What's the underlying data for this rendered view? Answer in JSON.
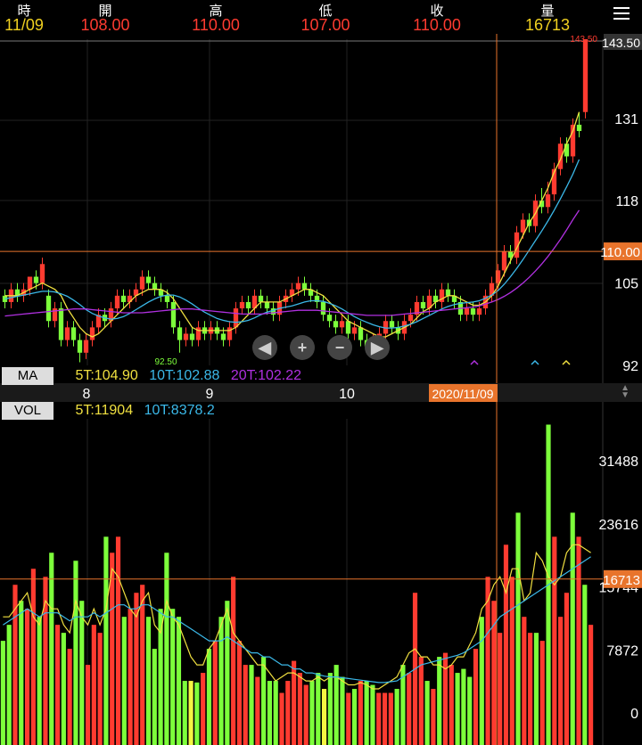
{
  "header": {
    "labels": [
      "時",
      "開",
      "高",
      "低",
      "收",
      "量"
    ],
    "values": [
      "11/09",
      "108.00",
      "110.00",
      "107.00",
      "110.00",
      "16713"
    ],
    "colors": [
      "#f0d020",
      "#ff3b30",
      "#ff3b30",
      "#ff3b30",
      "#ff3b30",
      "#f0d020"
    ]
  },
  "indicators": {
    "ma_tag": "MA",
    "ma5": "5T:104.90",
    "ma10": "10T:102.88",
    "ma20": "20T:102.22",
    "vol_tag": "VOL",
    "vol5": "5T:11904",
    "vol10": "10T:8378.2"
  },
  "colors": {
    "up": "#ff3b30",
    "down": "#7dff3b",
    "flat": "#f5f542",
    "ma5": "#f0e040",
    "ma10": "#3bb8e8",
    "ma20": "#b030e0",
    "cursor": "#e8742c"
  },
  "chart_data": [
    {
      "type": "candlestick",
      "y_ticks": [
        92,
        105,
        118,
        131,
        143.5
      ],
      "ylim": [
        92,
        143.5
      ],
      "cursor_value": "110.00",
      "high_label": "143.50",
      "low_label": "92.50",
      "x_labels": [
        "8",
        "9",
        "10",
        "2020/11/09"
      ],
      "candles": [
        [
          103,
          102,
          104,
          101
        ],
        [
          102,
          104,
          105,
          101
        ],
        [
          104,
          103,
          105,
          102
        ],
        [
          103,
          104,
          105,
          102
        ],
        [
          104,
          106,
          106,
          103
        ],
        [
          106,
          105,
          107,
          104
        ],
        [
          105,
          108,
          109,
          104
        ],
        [
          103,
          99,
          104,
          98
        ],
        [
          99,
          101,
          102,
          98
        ],
        [
          101,
          96,
          102,
          95
        ],
        [
          96,
          98,
          99,
          95
        ],
        [
          98,
          96,
          99,
          95
        ],
        [
          96,
          94,
          97,
          92.5
        ],
        [
          94,
          96,
          97,
          93
        ],
        [
          96,
          98,
          99,
          95
        ],
        [
          98,
          100,
          101,
          97
        ],
        [
          100,
          99,
          101,
          98
        ],
        [
          99,
          101,
          102,
          98
        ],
        [
          101,
          103,
          104,
          100
        ],
        [
          103,
          102,
          104,
          101
        ],
        [
          102,
          103,
          104,
          101
        ],
        [
          103,
          104,
          105,
          102
        ],
        [
          104,
          106,
          107,
          103
        ],
        [
          106,
          105,
          107,
          104
        ],
        [
          105,
          104,
          106,
          103
        ],
        [
          104,
          103,
          105,
          102
        ],
        [
          103,
          102,
          104,
          101
        ],
        [
          102,
          98,
          103,
          97
        ],
        [
          98,
          96,
          99,
          94
        ],
        [
          96,
          97,
          98,
          95
        ],
        [
          97,
          96,
          98,
          95
        ],
        [
          96,
          98,
          99,
          95
        ],
        [
          98,
          97,
          99,
          96
        ],
        [
          97,
          98,
          99,
          96
        ],
        [
          98,
          97,
          99,
          96
        ],
        [
          97,
          96,
          98,
          95
        ],
        [
          96,
          98,
          99,
          95
        ],
        [
          98,
          101,
          102,
          97
        ],
        [
          101,
          102,
          103,
          100
        ],
        [
          102,
          101,
          103,
          100
        ],
        [
          101,
          103,
          104,
          100
        ],
        [
          103,
          102,
          104,
          101
        ],
        [
          102,
          101,
          103,
          100
        ],
        [
          101,
          100,
          102,
          99
        ],
        [
          100,
          102,
          103,
          99
        ],
        [
          102,
          103,
          104,
          101
        ],
        [
          103,
          104,
          105,
          102
        ],
        [
          104,
          105,
          106,
          103
        ],
        [
          105,
          104,
          106,
          103
        ],
        [
          104,
          103,
          105,
          102
        ],
        [
          103,
          102,
          104,
          101
        ],
        [
          102,
          100,
          103,
          99
        ],
        [
          100,
          99,
          101,
          98
        ],
        [
          99,
          98,
          100,
          97
        ],
        [
          98,
          99,
          100,
          97
        ],
        [
          99,
          97,
          100,
          96
        ],
        [
          97,
          98,
          99,
          96
        ],
        [
          98,
          96,
          99,
          95
        ],
        [
          96,
          95,
          97,
          94
        ],
        [
          95,
          96,
          97,
          94
        ],
        [
          96,
          97,
          98,
          95
        ],
        [
          97,
          99,
          100,
          96
        ],
        [
          99,
          98,
          100,
          97
        ],
        [
          98,
          97,
          99,
          96
        ],
        [
          97,
          99,
          100,
          96
        ],
        [
          99,
          100,
          101,
          98
        ],
        [
          100,
          102,
          103,
          99
        ],
        [
          102,
          101,
          103,
          100
        ],
        [
          101,
          103,
          104,
          100
        ],
        [
          103,
          102,
          104,
          101
        ],
        [
          102,
          104,
          105,
          101
        ],
        [
          104,
          103,
          105,
          102
        ],
        [
          103,
          102,
          104,
          101
        ],
        [
          102,
          100,
          103,
          99
        ],
        [
          100,
          101,
          102,
          99
        ],
        [
          101,
          100,
          102,
          99
        ],
        [
          100,
          101,
          102,
          99
        ],
        [
          101,
          103,
          104,
          100
        ],
        [
          103,
          105,
          106,
          102
        ],
        [
          105,
          107,
          108,
          104
        ],
        [
          107,
          110,
          111,
          106
        ],
        [
          110,
          109,
          111,
          108
        ],
        [
          109,
          113,
          114,
          108
        ],
        [
          113,
          115,
          116,
          112
        ],
        [
          115,
          114,
          116,
          113
        ],
        [
          114,
          118,
          119,
          113
        ],
        [
          118,
          117,
          120,
          116
        ],
        [
          117,
          119,
          121,
          116
        ],
        [
          119,
          123,
          124,
          118
        ],
        [
          123,
          127,
          128,
          122
        ],
        [
          127,
          125,
          128,
          124
        ],
        [
          125,
          130,
          131,
          124
        ],
        [
          130,
          129,
          132,
          128
        ],
        [
          132,
          143.5,
          143.5,
          131
        ]
      ],
      "ma5": [
        103,
        103,
        103,
        103.5,
        104,
        104.5,
        105,
        104.5,
        104,
        103,
        101,
        99.5,
        98,
        97,
        96.5,
        97,
        98,
        99,
        100,
        101,
        102,
        103,
        103.5,
        104,
        104,
        104,
        103.5,
        102.5,
        101,
        99.5,
        98,
        97.5,
        97.5,
        97.5,
        97.5,
        97.5,
        97.5,
        98,
        99,
        100,
        101,
        102,
        102,
        102,
        102,
        102.5,
        103,
        103.5,
        104,
        104,
        103.5,
        103,
        102,
        101,
        100,
        99,
        98.5,
        98,
        97.5,
        97,
        96.5,
        96.5,
        97,
        97.5,
        98,
        98.5,
        99.5,
        100.5,
        101,
        102,
        102.5,
        103,
        103,
        102.5,
        102,
        101.5,
        101.5,
        102,
        103,
        104.5,
        106.5,
        108.5,
        110.5,
        112.5,
        114.5,
        116,
        118,
        120,
        122.5,
        124.5,
        127,
        129,
        132
      ],
      "ma10": [
        102.5,
        102.7,
        102.9,
        103.1,
        103.3,
        103.5,
        103.7,
        103.7,
        103.6,
        103.3,
        102.9,
        102.3,
        101.6,
        100.8,
        100.2,
        99.8,
        99.5,
        99.3,
        99.4,
        99.7,
        100.2,
        100.8,
        101.4,
        102,
        102.5,
        102.9,
        103.1,
        103.1,
        102.8,
        102.3,
        101.7,
        101,
        100.4,
        99.9,
        99.4,
        99.1,
        98.9,
        98.8,
        98.9,
        99.1,
        99.5,
        100,
        100.4,
        100.7,
        101,
        101.2,
        101.4,
        101.7,
        102,
        102.2,
        102.2,
        102.1,
        101.8,
        101.4,
        100.9,
        100.3,
        99.7,
        99.2,
        98.8,
        98.4,
        98.1,
        97.9,
        97.9,
        98,
        98.2,
        98.5,
        98.9,
        99.4,
        99.9,
        100.4,
        100.9,
        101.3,
        101.6,
        101.8,
        101.9,
        102,
        102.2,
        102.6,
        103.1,
        103.8,
        104.8,
        106,
        107.3,
        108.7,
        110.2,
        111.7,
        113.2,
        114.8,
        116.5,
        118.3,
        120.2,
        122.2,
        124.5
      ],
      "ma20": [
        99.8,
        99.9,
        100,
        100.1,
        100.2,
        100.3,
        100.4,
        100.5,
        100.6,
        100.7,
        100.8,
        100.9,
        100.9,
        100.9,
        100.8,
        100.7,
        100.6,
        100.5,
        100.4,
        100.3,
        100.3,
        100.3,
        100.3,
        100.4,
        100.5,
        100.6,
        100.7,
        100.8,
        100.9,
        100.9,
        100.9,
        100.8,
        100.7,
        100.6,
        100.5,
        100.4,
        100.3,
        100.2,
        100.1,
        100.1,
        100.1,
        100.1,
        100.2,
        100.3,
        100.4,
        100.5,
        100.6,
        100.7,
        100.7,
        100.7,
        100.7,
        100.6,
        100.5,
        100.4,
        100.3,
        100.2,
        100.1,
        100,
        99.9,
        99.9,
        99.9,
        99.9,
        99.9,
        100,
        100.1,
        100.2,
        100.3,
        100.4,
        100.5,
        100.6,
        100.7,
        100.8,
        100.9,
        101,
        101.1,
        101.2,
        101.4,
        101.7,
        102,
        102.4,
        102.9,
        103.5,
        104.2,
        105,
        105.9,
        106.9,
        108,
        109.2,
        110.5,
        111.9,
        113.4,
        115,
        116.5
      ]
    },
    {
      "type": "bar",
      "y_ticks": [
        0,
        7872,
        15744,
        23616,
        31488
      ],
      "ylim": [
        0,
        36500
      ],
      "cursor_value": "16713",
      "volumes": [
        9000,
        11000,
        16000,
        14000,
        13000,
        18000,
        12000,
        17000,
        20000,
        11000,
        10000,
        8000,
        19000,
        14000,
        6000,
        11000,
        10000,
        22000,
        20000,
        22000,
        12000,
        13000,
        15000,
        16000,
        12000,
        8000,
        13000,
        20000,
        13000,
        12000,
        4000,
        4000,
        3800,
        5000,
        8000,
        9000,
        12000,
        14000,
        17000,
        9000,
        6000,
        6000,
        4500,
        7000,
        4000,
        4000,
        2500,
        4000,
        6500,
        5000,
        3500,
        4000,
        5000,
        3000,
        5000,
        6000,
        4500,
        2500,
        3000,
        4000,
        4000,
        3500,
        2500,
        2500,
        2500,
        3000,
        6000,
        5000,
        15000,
        7000,
        4000,
        3000,
        7000,
        7500,
        6000,
        5000,
        5500,
        4500,
        8000,
        12000,
        17000,
        14000,
        10000,
        21000,
        17000,
        25000,
        12000,
        10000,
        10000,
        9000,
        36000,
        22000,
        12000,
        15000,
        25000,
        22000,
        16000,
        11000
      ],
      "ma5": [
        12000,
        12000,
        13000,
        14000,
        15000,
        12000,
        11000,
        14000,
        13000,
        13000,
        11000,
        10000,
        14000,
        12000,
        11000,
        13000,
        11000,
        13000,
        18000,
        17000,
        15000,
        13000,
        12000,
        14000,
        15000,
        11000,
        10000,
        14000,
        12000,
        11000,
        9000,
        7000,
        6000,
        6000,
        8000,
        9000,
        11000,
        13000,
        10000,
        9000,
        8000,
        7000,
        6000,
        6000,
        5000,
        4000,
        4500,
        5000,
        5000,
        4500,
        4000,
        4000,
        4500,
        4000,
        4500,
        4500,
        4000,
        3500,
        3500,
        3800,
        3500,
        3000,
        3000,
        3500,
        4000,
        4500,
        6000,
        7500,
        8000,
        7000,
        7000,
        6000,
        6000,
        5500,
        6000,
        7000,
        7000,
        8500,
        10000,
        13000,
        14000,
        16000,
        17000,
        15000,
        18000,
        18000,
        14000,
        15000,
        20000,
        19000,
        17000,
        16000,
        17000,
        20000,
        21000,
        21000,
        20500,
        20000
      ],
      "ma10": [
        11000,
        11500,
        12000,
        12500,
        13000,
        12500,
        12000,
        12500,
        12500,
        12500,
        12000,
        11500,
        12000,
        12000,
        12000,
        12500,
        12000,
        12500,
        13000,
        13500,
        13500,
        13000,
        13000,
        13500,
        13500,
        13000,
        12500,
        12000,
        12000,
        11500,
        11000,
        10500,
        10000,
        9500,
        9000,
        9000,
        9000,
        9500,
        9000,
        8500,
        8000,
        7500,
        7500,
        7000,
        7000,
        6500,
        6000,
        6000,
        5500,
        5500,
        5000,
        5000,
        4800,
        4600,
        4500,
        4500,
        4400,
        4300,
        4200,
        4100,
        4000,
        3900,
        3800,
        3800,
        3900,
        4000,
        4500,
        5000,
        5500,
        6000,
        6200,
        6400,
        6600,
        6800,
        7000,
        7200,
        7500,
        8000,
        8500,
        9000,
        10000,
        11000,
        12000,
        12500,
        13000,
        13500,
        14000,
        14500,
        15000,
        15500,
        16000,
        16500,
        17000,
        17500,
        18000,
        18500,
        19000,
        19500
      ]
    }
  ]
}
